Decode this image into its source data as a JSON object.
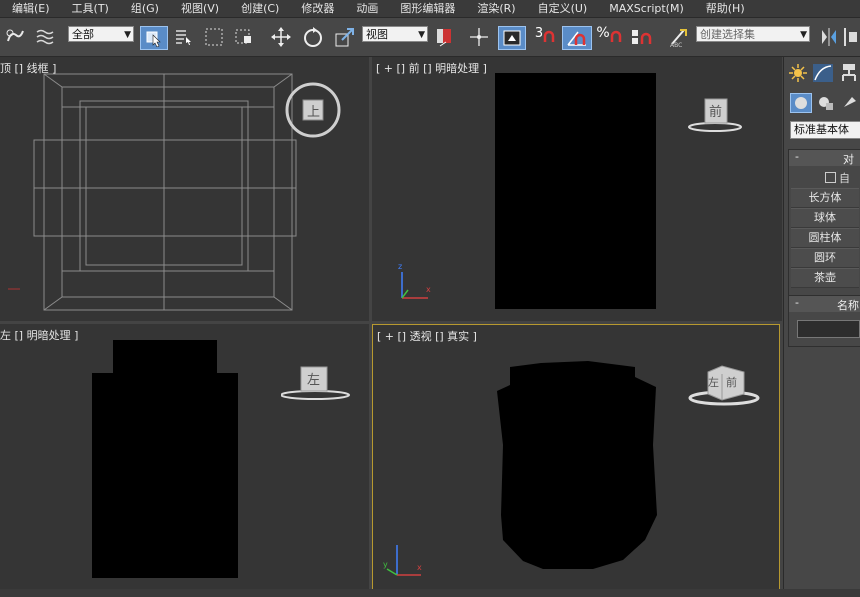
{
  "menu": [
    "编辑(E)",
    "工具(T)",
    "组(G)",
    "视图(V)",
    "创建(C)",
    "修改器",
    "动画",
    "图形编辑器",
    "渲染(R)",
    "自定义(U)",
    "MAXScript(M)",
    "帮助(H)"
  ],
  "toolbar": {
    "selection_filter": "全部",
    "ref_coord": "视图",
    "named_selection": "创建选择集",
    "snap_3": "3",
    "percent_snap": "%"
  },
  "viewports": {
    "top": {
      "label": "顶 [] 线框 ]",
      "cube_label": "上"
    },
    "front": {
      "label": "[ + [] 前 [] 明暗处理 ]",
      "cube_label": "前"
    },
    "left": {
      "label": "左 [] 明暗处理 ]",
      "cube_label": "左"
    },
    "persp": {
      "label": "[ + [] 透视 [] 真实 ]",
      "cube_left": "左",
      "cube_front": "前"
    }
  },
  "axis": {
    "x": "x",
    "y": "y",
    "z": "z"
  },
  "panel": {
    "category": "标准基本体",
    "rollout_objects_title": "对",
    "autogrid": "自",
    "buttons": [
      "长方体",
      "球体",
      "圆柱体",
      "圆环",
      "茶壶"
    ],
    "rollout_name_title": "名称"
  },
  "colors": {
    "active_viewport_border": "#b7992f",
    "toolbar_active": "#5a8cc7"
  }
}
